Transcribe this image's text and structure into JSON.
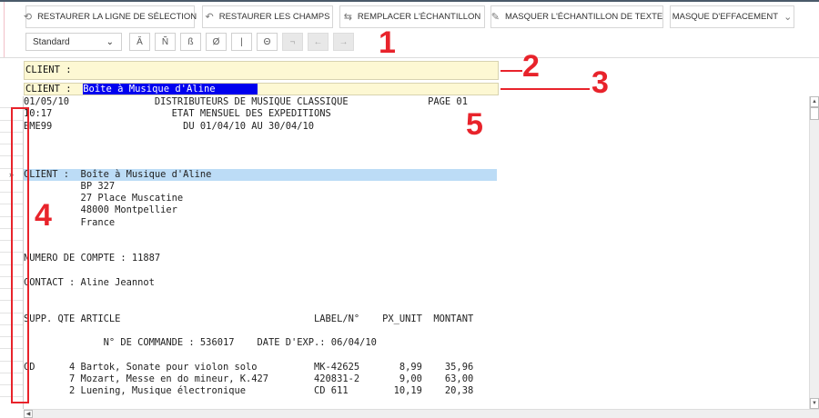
{
  "toolbar": {
    "buttons": [
      {
        "label": "RESTAURER LA LIGNE DE SÉLECTION",
        "icon": "restore-selection-icon"
      },
      {
        "label": "RESTAURER LES CHAMPS",
        "icon": "restore-fields-icon"
      },
      {
        "label": "REMPLACER L'ÉCHANTILLON",
        "icon": "replace-sample-icon"
      },
      {
        "label": "MASQUER L'ÉCHANTILLON DE TEXTE",
        "icon": "mask-text-icon"
      },
      {
        "label": "MASQUE D'EFFACEMENT",
        "icon": "chevron-down-icon"
      }
    ],
    "charset": "Standard",
    "chars": [
      "Ă",
      "Ñ",
      "ß",
      "Ø",
      "|",
      "Θ",
      "¬",
      "←",
      "→"
    ]
  },
  "fields": {
    "sample_field": "CLIENT :",
    "selection_prefix": "CLIENT :  ",
    "selection_value": "Boîte à Musique d'Aline"
  },
  "report": {
    "lines": [
      "01/05/10               DISTRIBUTEURS DE MUSIQUE CLASSIQUE              PAGE 01",
      "10:17                     ETAT MENSUEL DES EXPEDITIONS",
      "BME99                       DU 01/04/10 AU 30/04/10",
      "",
      "",
      "",
      "CLIENT :  Boîte à Musique d'Aline",
      "          BP 327",
      "          27 Place Muscatine",
      "          48000 Montpellier",
      "          France",
      "",
      "",
      "NUMERO DE COMPTE : 11887",
      "",
      "CONTACT : Aline Jeannot",
      "",
      "",
      "SUPP. QTE ARTICLE                                  LABEL/N°    PX_UNIT  MONTANT",
      "",
      "              N° DE COMMANDE : 536017    DATE D'EXP.: 06/04/10",
      "",
      "CD      4 Bartok, Sonate pour violon solo          MK-42625       8,99    35,96",
      "        7 Mozart, Messe en do mineur, K.427        420831-2       9,00    63,00",
      "        2 Luening, Musique électronique            CD 611        10,19    20,38"
    ],
    "current_marker": "»"
  },
  "annotations": [
    "1",
    "2",
    "3",
    "4",
    "5"
  ]
}
